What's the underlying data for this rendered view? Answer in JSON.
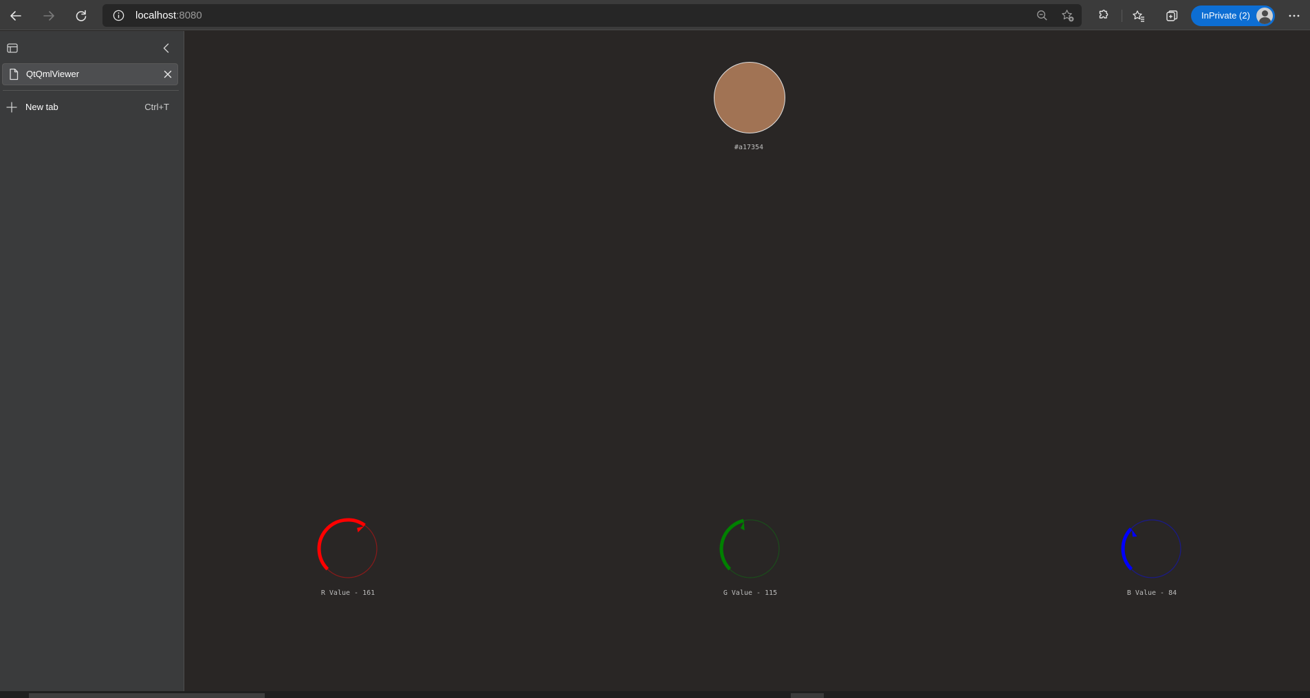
{
  "browser": {
    "url_host": "localhost",
    "url_port": ":8080",
    "inprivate_label": "InPrivate (2)"
  },
  "sidebar": {
    "tabs": [
      {
        "label": "QtQmlViewer",
        "active": true
      }
    ],
    "new_tab_label": "New tab",
    "new_tab_shortcut": "Ctrl+T"
  },
  "app": {
    "color_hex": "#a17354",
    "channels": [
      {
        "name": "R",
        "label": "R Value - 161",
        "value": 161,
        "max": 255,
        "color": "#ff0000",
        "track_color": "#8b1a1a"
      },
      {
        "name": "G",
        "label": "G Value - 115",
        "value": 115,
        "max": 255,
        "color": "#008000",
        "track_color": "#1b4d1b"
      },
      {
        "name": "B",
        "label": "B Value - 84",
        "value": 84,
        "max": 255,
        "color": "#0000ff",
        "track_color": "#1a1a8b"
      }
    ]
  },
  "icons": {
    "back": "back-arrow-icon",
    "forward": "forward-arrow-icon",
    "refresh": "refresh-icon",
    "info": "info-icon",
    "zoom": "zoom-out-icon",
    "favorite": "add-favorite-icon",
    "extensions": "extensions-icon",
    "favorites": "favorites-icon",
    "collections": "collections-icon",
    "menu": "more-menu-icon"
  }
}
